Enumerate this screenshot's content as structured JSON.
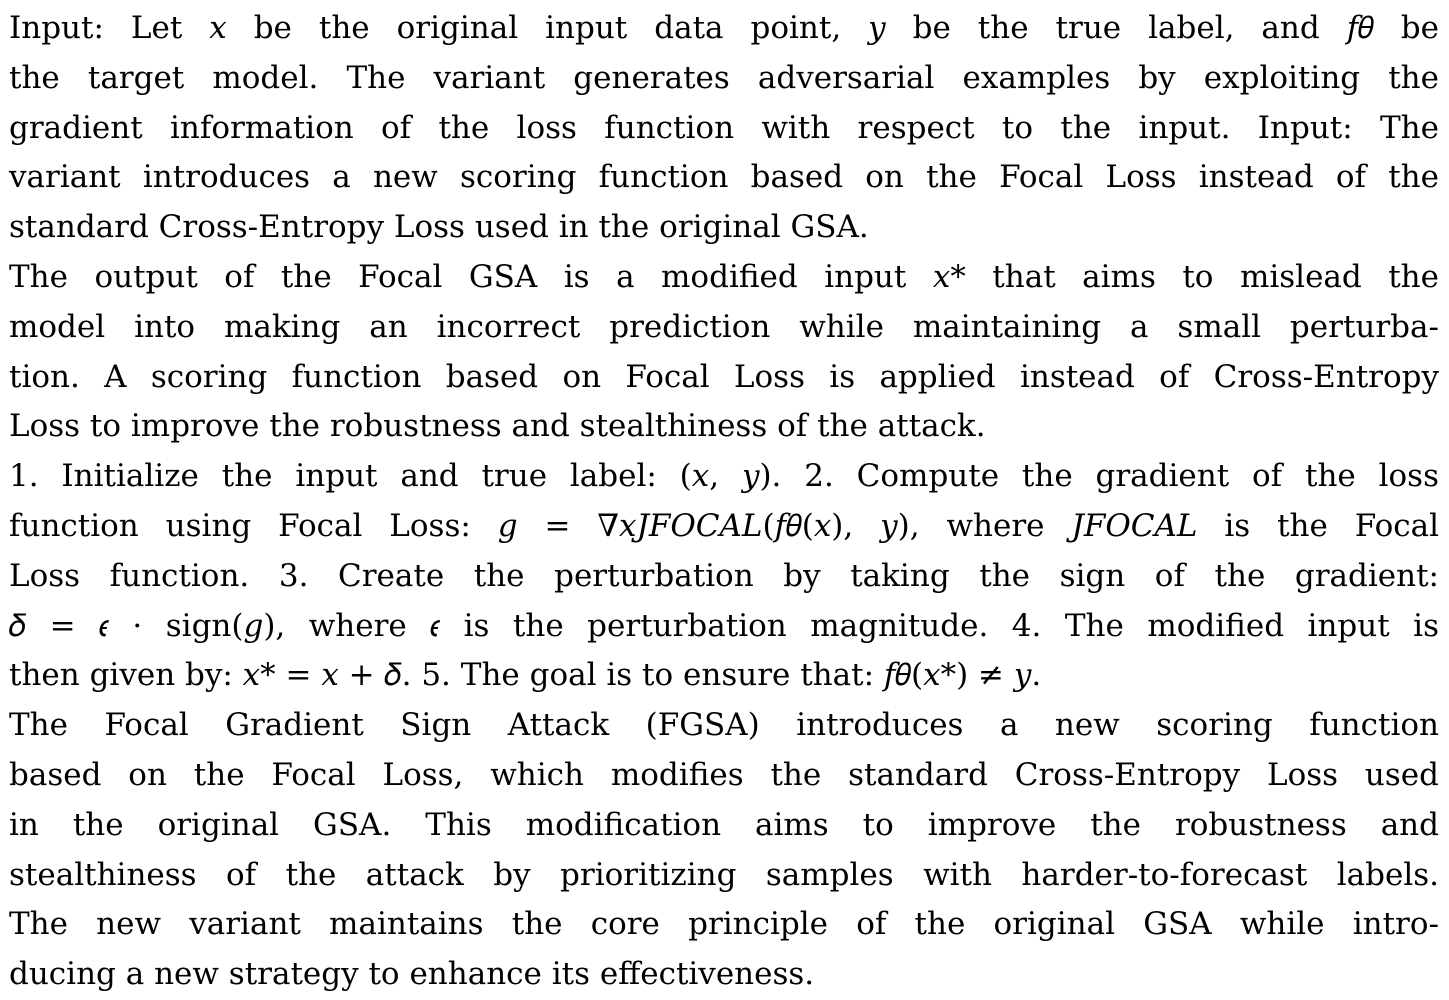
{
  "document": {
    "paragraphs": [
      {
        "lines": [
          "Input: Let 𝑥 be the original input data point, 𝑦 be the true label, and 𝑓𝜃 be",
          "the target model. The variant generates adversarial examples by exploiting the",
          "gradient information of the loss function with respect to the input. Input: The",
          "variant introduces a new scoring function based on the Focal Loss instead of the",
          "standard Cross-Entropy Loss used in the original GSA."
        ]
      },
      {
        "lines": [
          "The output of the Focal GSA is a modified input 𝑥* that aims to mislead the",
          "model into making an incorrect prediction while maintaining a small perturba-",
          "tion. A scoring function based on Focal Loss is applied instead of Cross-Entropy",
          "Loss to improve the robustness and stealthiness of the attack."
        ]
      },
      {
        "lines": [
          "1. Initialize the input and true label: (𝑥, 𝑦). 2. Compute the gradient of the loss",
          "function using Focal Loss: 𝑔 = ∇𝑥𝐽𝐹𝑂𝐶𝐴𝐿(𝑓𝜃(𝑥), 𝑦), where 𝐽𝐹𝑂𝐶𝐴𝐿 is the Focal",
          "Loss function. 3. Create the perturbation by taking the sign of the gradient:",
          "𝛿 = 𝜖 · sign(𝑔), where 𝜖 is the perturbation magnitude. 4. The modified input is",
          "then given by: 𝑥* = 𝑥 + 𝛿. 5. The goal is to ensure that: 𝑓𝜃(𝑥*) ≠ 𝑦."
        ]
      },
      {
        "lines": [
          "The Focal Gradient Sign Attack (FGSA) introduces a new scoring function",
          "based on the Focal Loss, which modifies the standard Cross-Entropy Loss used",
          "in the original GSA. This modification aims to improve the robustness and",
          "stealthiness of the attack by prioritizing samples with harder-to-forecast labels.",
          "The new variant maintains the core principle of the original GSA while intro-",
          "ducing a new strategy to enhance its effectiveness."
        ]
      }
    ]
  }
}
